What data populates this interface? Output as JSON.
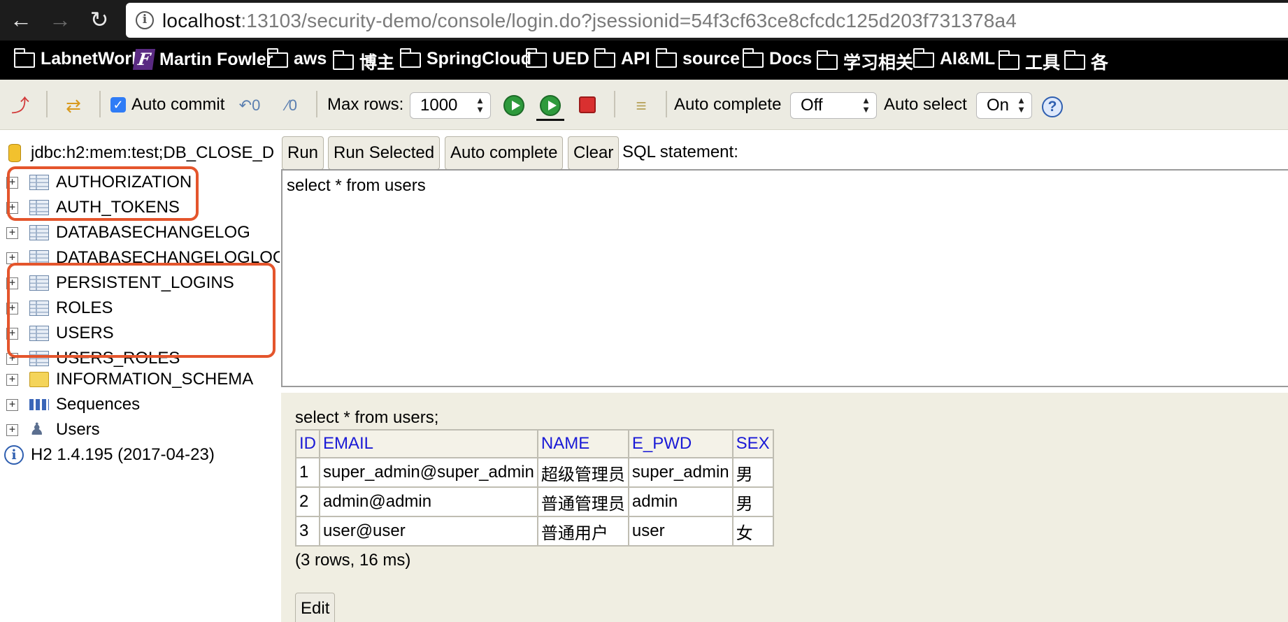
{
  "browser": {
    "url_host": "localhost",
    "url_rest": ":13103/security-demo/console/login.do?jsessionid=54f3cf63ce8cfcdc125d203f731378a4",
    "bookmarks": [
      {
        "label": "LabnetWork",
        "icon": "folder-icon"
      },
      {
        "label": "Martin Fowler",
        "icon": "martin-fowler-favicon"
      },
      {
        "label": "aws",
        "icon": "folder-icon"
      },
      {
        "label": "博主",
        "icon": "folder-icon"
      },
      {
        "label": "SpringCloud",
        "icon": "folder-icon"
      },
      {
        "label": "UED",
        "icon": "folder-icon"
      },
      {
        "label": "API",
        "icon": "folder-icon"
      },
      {
        "label": "source",
        "icon": "folder-icon"
      },
      {
        "label": "Docs",
        "icon": "folder-icon"
      },
      {
        "label": "学习相关",
        "icon": "folder-icon"
      },
      {
        "label": "AI&ML",
        "icon": "folder-icon"
      },
      {
        "label": "工具",
        "icon": "folder-icon"
      },
      {
        "label": "各",
        "icon": "folder-icon"
      }
    ]
  },
  "toolbar": {
    "auto_commit_label": "Auto commit",
    "auto_commit_checked": true,
    "max_rows_label": "Max rows:",
    "max_rows_value": "1000",
    "auto_complete_label": "Auto complete",
    "auto_complete_value": "Off",
    "auto_select_label": "Auto select",
    "auto_select_value": "On",
    "help_glyph": "?"
  },
  "tree": {
    "connection": "jdbc:h2:mem:test;DB_CLOSE_D",
    "tables": [
      "AUTHORIZATION",
      "AUTH_TOKENS",
      "DATABASECHANGELOG",
      "DATABASECHANGELOGLOCK",
      "PERSISTENT_LOGINS",
      "ROLES",
      "USERS",
      "USERS_ROLES"
    ],
    "information_schema": "INFORMATION_SCHEMA",
    "sequences": "Sequences",
    "users": "Users",
    "version": "H2 1.4.195 (2017-04-23)",
    "highlight_color": "#e4552c"
  },
  "query": {
    "run_label": "Run",
    "run_selected_label": "Run Selected",
    "auto_complete_label": "Auto complete",
    "clear_label": "Clear",
    "sql_statement_label": "SQL statement:",
    "sql_text": "select * from users"
  },
  "result": {
    "query_echo": "select * from users;",
    "columns": [
      "ID",
      "EMAIL",
      "NAME",
      "E_PWD",
      "SEX"
    ],
    "rows": [
      [
        "1",
        "super_admin@super_admin",
        "超级管理员",
        "super_admin",
        "男"
      ],
      [
        "2",
        "admin@admin",
        "普通管理员",
        "admin",
        "男"
      ],
      [
        "3",
        "user@user",
        "普通用户",
        "user",
        "女"
      ]
    ],
    "meta": "(3 rows, 16 ms)",
    "edit_label": "Edit"
  }
}
